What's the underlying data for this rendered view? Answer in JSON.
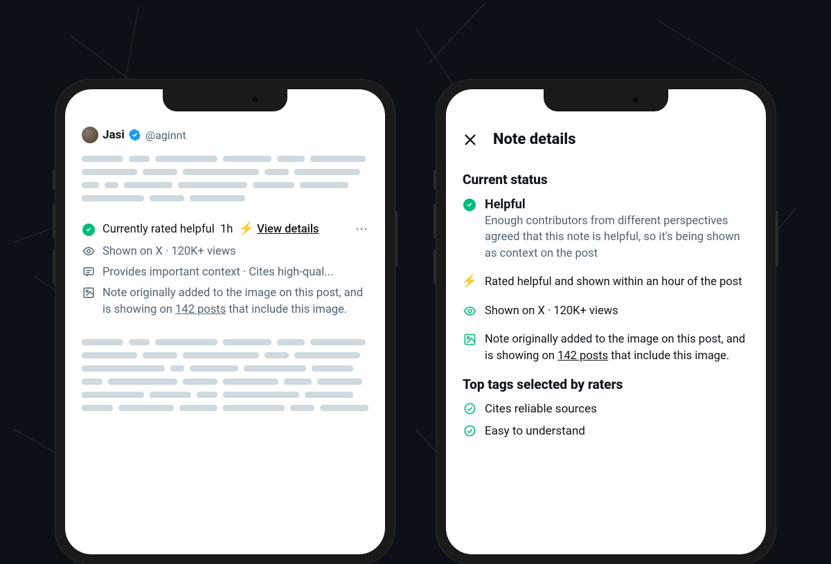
{
  "colors": {
    "accent_green": "#00ba7c",
    "verified_blue": "#1d9bf0",
    "bolt_yellow": "#ffd400",
    "text_primary": "#0f1419",
    "text_secondary": "#536471"
  },
  "phone1": {
    "author": {
      "name": "Jasi",
      "handle": "@aginnt",
      "verified": true
    },
    "note": {
      "status_line": {
        "label": "Currently rated helpful",
        "time": "1h",
        "action": "View details"
      },
      "shown_line": "Shown on X · 120K+ views",
      "tags_line": "Provides important context · Cites high-qual...",
      "origin_line_prefix": "Note originally added to the image on this post, and is showing on ",
      "origin_link": "142 posts",
      "origin_line_suffix": " that include this image."
    }
  },
  "phone2": {
    "title": "Note details",
    "status_section_title": "Current status",
    "status_items": [
      {
        "icon": "check",
        "label": "Helpful",
        "desc": "Enough contributors from different perspectives agreed that this note is helpful, so it's being shown as context on the post"
      },
      {
        "icon": "bolt",
        "desc": "Rated helpful and shown within an hour of the post"
      },
      {
        "icon": "eye",
        "desc": "Shown on X · 120K+ views"
      },
      {
        "icon": "image",
        "desc_prefix": "Note originally added to the image on this post, and is showing on ",
        "desc_link": "142 posts",
        "desc_suffix": " that include this image."
      }
    ],
    "tags_section_title": "Top tags selected by raters",
    "tags": [
      "Cites reliable sources",
      "Easy to understand"
    ]
  }
}
